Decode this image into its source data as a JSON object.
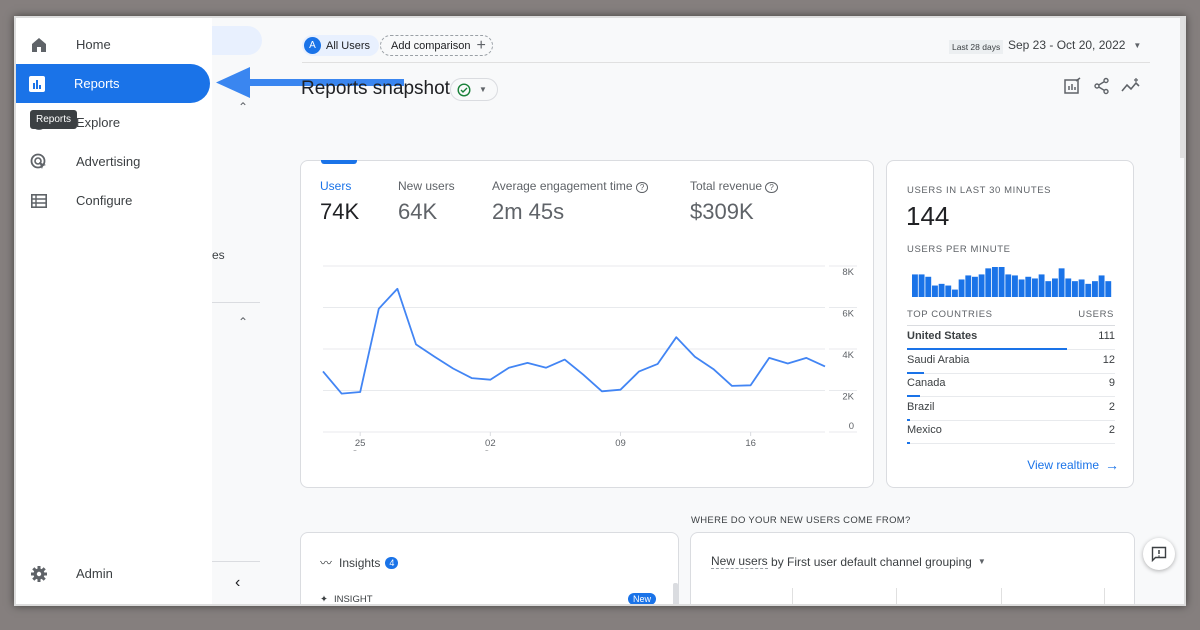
{
  "nav": {
    "items": [
      {
        "label": "Home",
        "icon": "home-icon"
      },
      {
        "label": "Reports",
        "icon": "bar-chart-icon",
        "active": true
      },
      {
        "label": "Explore",
        "icon": "explore-icon"
      },
      {
        "label": "Advertising",
        "icon": "advertising-icon"
      },
      {
        "label": "Configure",
        "icon": "list-icon"
      }
    ],
    "admin": "Admin",
    "tooltip": "Reports"
  },
  "background_text": "ses",
  "header": {
    "audience_avatar": "A",
    "audience": "All Users",
    "add_comparison": "Add comparison",
    "date_preset": "Last 28 days",
    "date_range": "Sep 23 - Oct 20, 2022",
    "title": "Reports snapshot"
  },
  "metrics": [
    {
      "label": "Users",
      "value": "74K"
    },
    {
      "label": "New users",
      "value": "64K"
    },
    {
      "label": "Average engagement time",
      "value": "2m 45s"
    },
    {
      "label": "Total revenue",
      "value": "$309K"
    }
  ],
  "chart_data": {
    "type": "line",
    "x": [
      "Sep 23",
      "Sep 24",
      "Sep 25",
      "Sep 26",
      "Sep 27",
      "Sep 28",
      "Sep 29",
      "Sep 30",
      "Oct 01",
      "Oct 02",
      "Oct 03",
      "Oct 04",
      "Oct 05",
      "Oct 06",
      "Oct 07",
      "Oct 08",
      "Oct 09",
      "Oct 10",
      "Oct 11",
      "Oct 12",
      "Oct 13",
      "Oct 14",
      "Oct 15",
      "Oct 16",
      "Oct 17",
      "Oct 18",
      "Oct 19",
      "Oct 20"
    ],
    "series": [
      {
        "values": [
          2920,
          1850,
          1930,
          5940,
          6900,
          4220,
          3630,
          3060,
          2600,
          2520,
          3100,
          3330,
          3100,
          3490,
          2760,
          1960,
          2040,
          2920,
          3280,
          4570,
          3630,
          3030,
          2220,
          2250,
          3570,
          3300,
          3570,
          3160
        ]
      }
    ],
    "ylim": [
      0,
      8000
    ],
    "y_ticks": [
      "0",
      "2K",
      "4K",
      "6K",
      "8K"
    ],
    "x_ticks": [
      {
        "day": "25",
        "month": "Sep"
      },
      {
        "day": "02",
        "month": "Oct"
      },
      {
        "day": "09",
        "month": ""
      },
      {
        "day": "16",
        "month": ""
      }
    ],
    "color": "#4285f4",
    "grid": true
  },
  "realtime": {
    "title": "USERS IN LAST 30 MINUTES",
    "value": "144",
    "per_minute_label": "USERS PER MINUTE",
    "per_minute_levels": [
      67,
      67,
      60,
      34,
      39,
      34,
      22,
      52,
      64,
      60,
      67,
      85,
      89,
      89,
      67,
      64,
      52,
      60,
      55,
      67,
      47,
      55,
      85,
      55,
      47,
      52,
      39,
      47,
      64,
      47
    ],
    "countries_header": "TOP COUNTRIES",
    "users_header": "USERS",
    "countries": [
      {
        "name": "United States",
        "users": "111"
      },
      {
        "name": "Saudi Arabia",
        "users": "12"
      },
      {
        "name": "Canada",
        "users": "9"
      },
      {
        "name": "Brazil",
        "users": "2"
      },
      {
        "name": "Mexico",
        "users": "2"
      }
    ],
    "link": "View realtime"
  },
  "bottom": {
    "section_title": "WHERE DO YOUR NEW USERS COME FROM?",
    "insights_label": "Insights",
    "insights_count": "4",
    "insight_tag": "INSIGHT",
    "new_badge": "New",
    "channel_metric": "New users",
    "channel_rest": "by First user default channel grouping"
  },
  "colors": {
    "accent": "#1a73e8",
    "line": "#4285f4",
    "success": "#188038"
  }
}
